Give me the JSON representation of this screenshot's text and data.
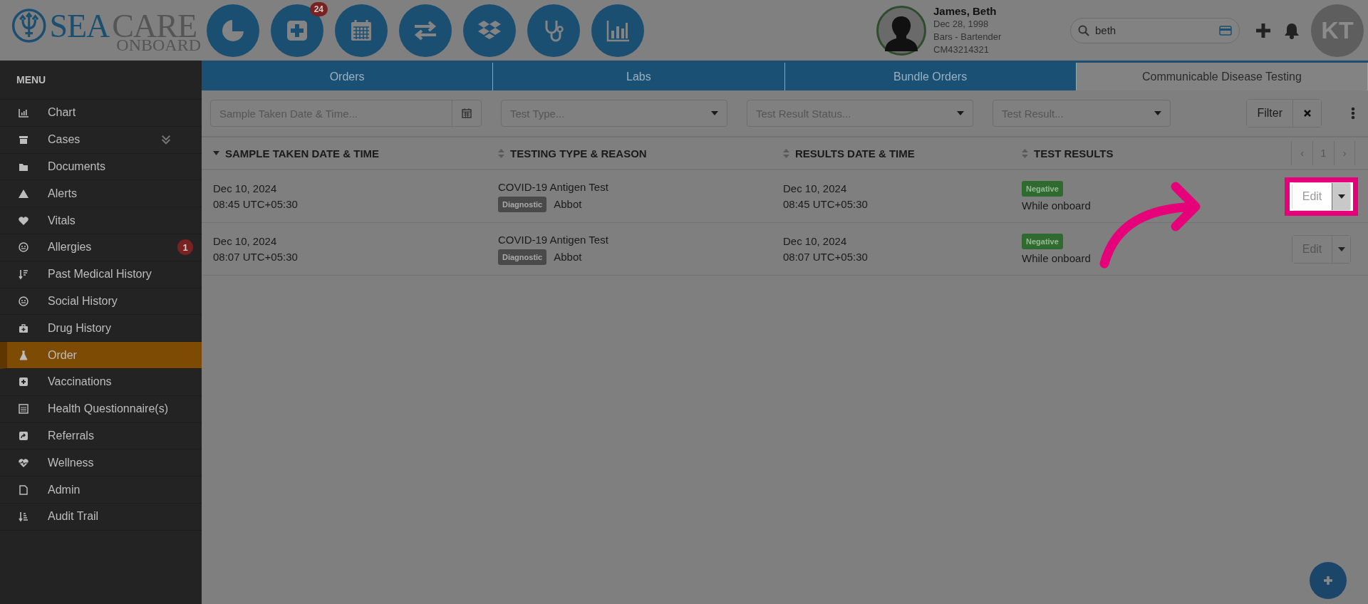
{
  "logo": {
    "word_1": "SEA",
    "word_2": "CARE",
    "subtitle": "ONBOARD"
  },
  "toolbar": {
    "badge": "24"
  },
  "patient": {
    "name": "James, Beth",
    "dob": "Dec 28, 1998",
    "occupation": "Bars - Bartender",
    "id": "CM43214321"
  },
  "search": {
    "value": "beth"
  },
  "user": {
    "initials": "KT"
  },
  "sidebar": {
    "title": "MENU",
    "items": [
      {
        "label": "Chart",
        "selected": false,
        "expandable": false
      },
      {
        "label": "Cases",
        "selected": false,
        "expandable": true
      },
      {
        "label": "Documents",
        "selected": false,
        "expandable": false
      },
      {
        "label": "Alerts",
        "selected": false,
        "expandable": false
      },
      {
        "label": "Vitals",
        "selected": false,
        "expandable": false
      },
      {
        "label": "Allergies",
        "selected": false,
        "badge": "1",
        "expandable": false
      },
      {
        "label": "Past Medical History",
        "selected": false,
        "expandable": false
      },
      {
        "label": "Social History",
        "selected": false,
        "expandable": false
      },
      {
        "label": "Drug History",
        "selected": false,
        "expandable": false
      },
      {
        "label": "Order",
        "selected": true,
        "expandable": false
      },
      {
        "label": "Vaccinations",
        "selected": false,
        "expandable": false
      },
      {
        "label": "Health Questionnaire(s)",
        "selected": false,
        "expandable": false
      },
      {
        "label": "Referrals",
        "selected": false,
        "expandable": false
      },
      {
        "label": "Wellness",
        "selected": false,
        "expandable": false
      },
      {
        "label": "Admin",
        "selected": false,
        "expandable": false
      },
      {
        "label": "Audit Trail",
        "selected": false,
        "expandable": false
      }
    ]
  },
  "tabs": [
    {
      "label": "Orders",
      "selected": false
    },
    {
      "label": "Labs",
      "selected": false
    },
    {
      "label": "Bundle Orders",
      "selected": false
    },
    {
      "label": "Communicable Disease Testing",
      "selected": true
    }
  ],
  "filters": {
    "date_placeholder": "Sample Taken Date & Time...",
    "selects": [
      "Test Type...",
      "Test Result Status...",
      "Test Result..."
    ],
    "filter_button": "Filter"
  },
  "table": {
    "columns": [
      {
        "label": "SAMPLE TAKEN DATE & TIME",
        "sorted": true
      },
      {
        "label": "TESTING TYPE & REASON",
        "sorted": false
      },
      {
        "label": "RESULTS DATE & TIME",
        "sorted": false
      },
      {
        "label": "TEST RESULTS",
        "sorted": false
      }
    ],
    "pagination": {
      "prev": "‹",
      "page": "1",
      "next": "›"
    },
    "rows": [
      {
        "sample_date": "Dec 10, 2024",
        "sample_time": "08:45 UTC+05:30",
        "test": "COVID-19 Antigen Test",
        "reason": "Diagnostic",
        "maker": "Abbot",
        "result_date": "Dec 10, 2024",
        "result_time": "08:45 UTC+05:30",
        "result": "Negative",
        "context": "While onboard",
        "action": "Edit",
        "highlighted": true
      },
      {
        "sample_date": "Dec 10, 2024",
        "sample_time": "08:07 UTC+05:30",
        "test": "COVID-19 Antigen Test",
        "reason": "Diagnostic",
        "maker": "Abbot",
        "result_date": "Dec 10, 2024",
        "result_time": "08:07 UTC+05:30",
        "result": "Negative",
        "context": "While onboard",
        "action": "Edit",
        "highlighted": false
      }
    ]
  }
}
